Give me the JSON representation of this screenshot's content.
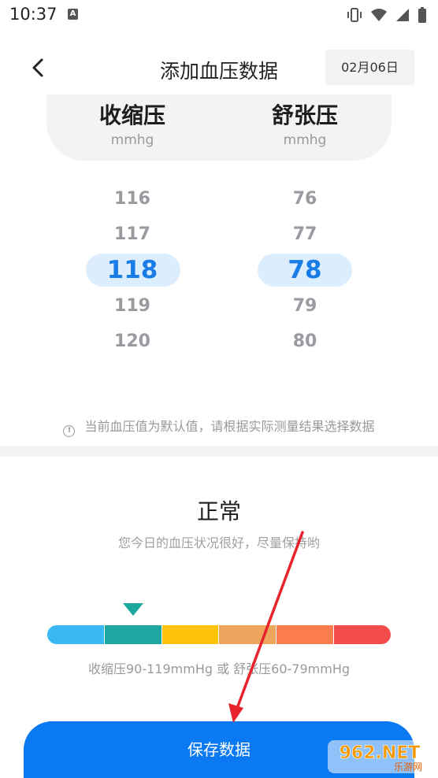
{
  "status_bar": {
    "time": "10:37",
    "notification_letter": "A",
    "icons": [
      "vibrate-icon",
      "wifi-icon",
      "signal-icon",
      "battery-icon"
    ]
  },
  "header": {
    "back_icon": "chevron-left-icon",
    "title": "添加血压数据",
    "date": "02月06日"
  },
  "columns": {
    "systolic": {
      "title": "收缩压",
      "unit": "mmhg",
      "values_above": [
        "116",
        "117"
      ],
      "selected": "118",
      "values_below": [
        "119",
        "120"
      ]
    },
    "diastolic": {
      "title": "舒张压",
      "unit": "mmhg",
      "values_above": [
        "76",
        "77"
      ],
      "selected": "78",
      "values_below": [
        "79",
        "80"
      ]
    }
  },
  "notice": {
    "icon": "info-icon",
    "icon_glyph": "!",
    "text": "当前血压值为默认值，请根据实际测量结果选择数据"
  },
  "result": {
    "title": "正常",
    "description": "您今日的血压状况很好，尽量保持哟",
    "scale_colors": [
      "#3ab8f3",
      "#1ea7a0",
      "#fdc30a",
      "#eba55d",
      "#fb7d4f",
      "#f44c4b"
    ],
    "marker_segment_index": 1,
    "range_text": "收缩压90-119mmHg 或 舒张压60-79mmHg"
  },
  "save_button": {
    "label": "保存数据"
  },
  "watermark": {
    "text": "962.NET",
    "subtext": "乐游网"
  },
  "colors": {
    "accent": "#0a79f2",
    "selected_text": "#1a7ce6",
    "annotation_arrow": "#e8232b"
  }
}
